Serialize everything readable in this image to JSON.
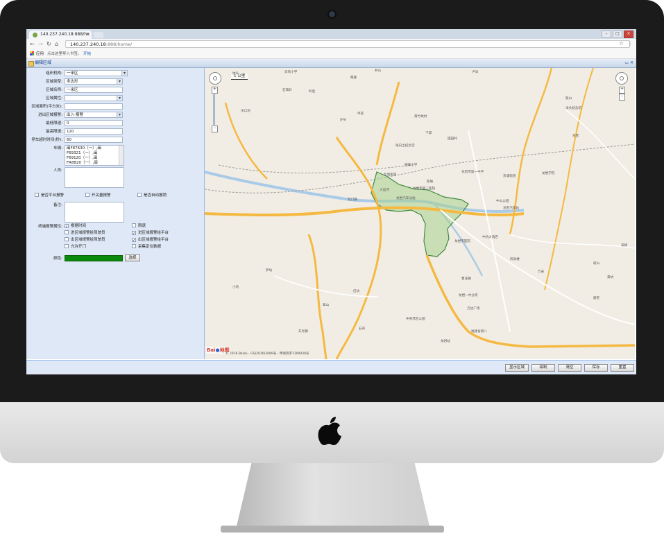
{
  "browser": {
    "tab_title": "140.237.240.18:888/ho",
    "url_host": "140.237.240.18",
    "url_path": ":888/home/",
    "bookmarks_apps": "应用",
    "bookmarks_hint": "点击这里导入书签。",
    "bookmarks_link": "开始"
  },
  "app": {
    "title": "编辑区域",
    "form": {
      "org_label": "组织机构:",
      "org_value": "一米区",
      "type_label": "区域类型:",
      "type_value": "多边形",
      "name_label": "区域名称:",
      "name_value": "一米区",
      "attr_label": "区域属性:",
      "attr_value": "",
      "area_label": "区域面积(平方米):",
      "area_value": "",
      "alarm_label": "进出区域报警:",
      "alarm_value": "出入-报警",
      "min_speed_label": "最低限速:",
      "min_speed_value": "0",
      "max_speed_label": "最高限速:",
      "max_speed_value": "120",
      "park_label": "停车超时时间(秒):",
      "park_value": "60",
      "vehicles_label": "车辆:",
      "vehicles": [
        "闽F87630（一）,闽",
        "F69321（一）,闽",
        "F69120（一）,闽",
        "FR8820（一）,闽"
      ],
      "people_label": "人员:",
      "platform_alarm": "是否平台报警",
      "switch_alarm": "开关量报警",
      "auto_cancel": "是否自动撤销",
      "remark_label": "备注:",
      "terminal_label": "终端报警属性:",
      "options": [
        {
          "label": "根据时间",
          "checked": true
        },
        {
          "label": "限速",
          "checked": false
        },
        {
          "label": "进区域报警给驾驶员",
          "checked": false
        },
        {
          "label": "进区域报警给平台",
          "checked": true
        },
        {
          "label": "出区域报警给驾驶员",
          "checked": false
        },
        {
          "label": "出区域报警给平台",
          "checked": true
        },
        {
          "label": "允许开门",
          "checked": false
        },
        {
          "label": "采集定位数据",
          "checked": false
        }
      ],
      "color_label": "颜色:",
      "color_value": "#0a8a0a",
      "select_button": "选择"
    },
    "map": {
      "scale": "1 公里",
      "logo_text": "Bai",
      "logo_text2": "地图",
      "copyright": "© 2018 Baidu - GS(2016)2089号 - 甲测资字1100930号",
      "labels": [
        "坑头",
        "白鸡小学",
        "井山",
        "卢洋",
        "石耳岭",
        "鹰厦",
        "岭后",
        "水口坊",
        "坪苗",
        "炉头",
        "黄竹坑村",
        "下邱",
        "国田村",
        "张白土纪念堂",
        "德峰小学",
        "北城街道",
        "陈陂",
        "大运河",
        "龙岩市第二医院",
        "龙岩市第一中学",
        "东城街道",
        "龙岩学院",
        "龙门镇",
        "龙岩汽车北站",
        "中山公园",
        "龙岩市医院",
        "龙岩汽车站",
        "中坑大酒店",
        "曹溪镇",
        "龙岩一中分校",
        "万达广场",
        "中央苏区公园",
        "龙岩站",
        "福建省第八",
        "小池",
        "罗坊",
        "翠山",
        "东肖镇",
        "红坊",
        "石背",
        "厦老",
        "风高楼",
        "万安",
        "溪柄",
        "洋头纪念馆",
        "铁山",
        "东宝",
        "岐山",
        "黄坑"
      ]
    },
    "buttons": [
      "显示区域",
      "绘制",
      "清空",
      "保存",
      "重置"
    ]
  }
}
